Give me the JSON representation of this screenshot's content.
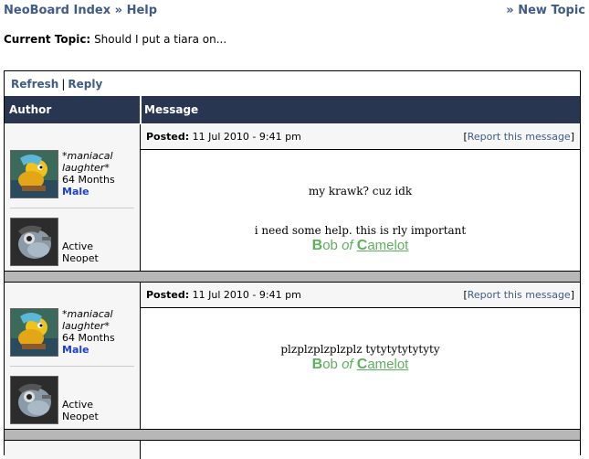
{
  "nav": {
    "board_index": "NeoBoard Index",
    "separator": "»",
    "current": "Help",
    "new_topic_prefix": "»",
    "new_topic": "New Topic"
  },
  "topic": {
    "label": "Current Topic:",
    "title": "Should I put a tiara on..."
  },
  "actions": {
    "refresh": "Refresh",
    "pipe": "|",
    "reply": "Reply"
  },
  "columns": {
    "author": "Author",
    "message": "Message"
  },
  "posts": [
    {
      "posted_label": "Posted:",
      "posted_date": "11 Jul 2010 - 9:41 pm",
      "report_open": "[",
      "report_link": "Report this message",
      "report_close": "]",
      "username": "*maniacal laughter*",
      "age": "64 Months",
      "gender": "Male",
      "neopet_label": "Active Neopet",
      "lines": [
        "my krawk? cuz idk",
        "i need some help. this is rly important"
      ],
      "sig": {
        "b": "B",
        "ob": "ob",
        "of": "of",
        "c": "C",
        "amelot": "amelot"
      }
    },
    {
      "posted_label": "Posted:",
      "posted_date": "11 Jul 2010 - 9:41 pm",
      "report_open": "[",
      "report_link": "Report this message",
      "report_close": "]",
      "username": "*maniacal laughter*",
      "age": "64 Months",
      "gender": "Male",
      "neopet_label": "Active Neopet",
      "lines": [
        "plzplzplzplzplz tytytytytytyty"
      ],
      "sig": {
        "b": "B",
        "ob": "ob",
        "of": "of",
        "c": "C",
        "amelot": "amelot"
      }
    }
  ],
  "colors": {
    "link": "#3f5b86",
    "header_bg": "#293652",
    "gender": "#1b3fd8",
    "signature": "#5db05d",
    "separator": "#b7b7b7"
  }
}
